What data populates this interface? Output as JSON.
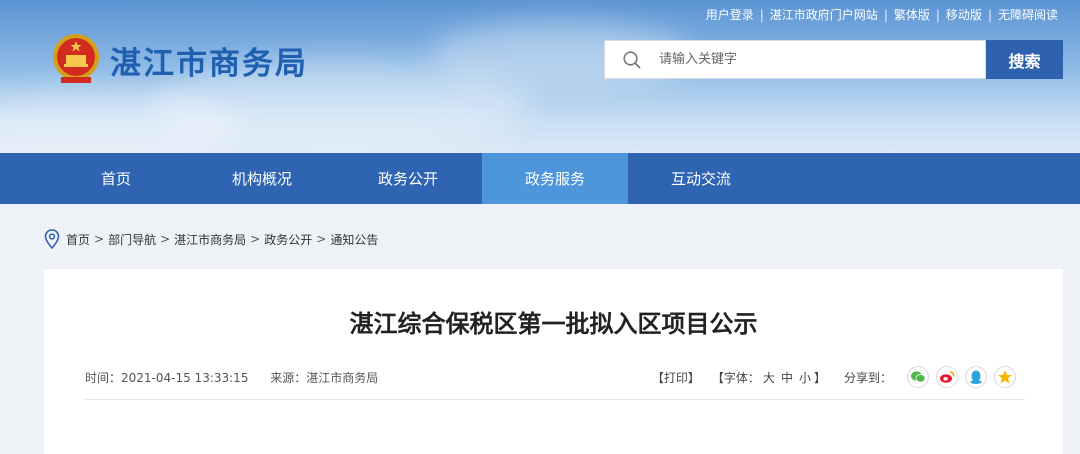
{
  "header": {
    "site_title": "湛江市商务局",
    "top_links": [
      "用户登录",
      "湛江市政府门户网站",
      "繁体版",
      "移动版",
      "无障碍阅读"
    ],
    "top_sep": "|",
    "search": {
      "placeholder": "请输入关键字",
      "button_label": "搜索"
    }
  },
  "nav": {
    "items": [
      "首页",
      "机构概况",
      "政务公开",
      "政务服务",
      "互动交流"
    ],
    "active_index": 3
  },
  "breadcrumb": {
    "items": [
      "首页",
      "部门导航",
      "湛江市商务局",
      "政务公开",
      "通知公告"
    ],
    "separator": ">"
  },
  "article": {
    "title": "湛江综合保税区第一批拟入区项目公示",
    "time": "时间：2021-04-15 13:33:15",
    "source": "来源：湛江市商务局",
    "print_label": "【打印】",
    "font_prefix": "【字体：",
    "font_sizes": [
      "大",
      "中",
      "小"
    ],
    "font_suffix": "】",
    "share_label": "分享到："
  },
  "colors": {
    "nav_bg": "#2f64b2",
    "nav_active": "#4d96dc",
    "title_blue": "#1e5fb0",
    "search_btn": "#2f62ae"
  },
  "icons": [
    "national-emblem-icon",
    "search-icon",
    "location-pin-icon",
    "wechat-icon",
    "weibo-icon",
    "qq-icon",
    "qzone-icon"
  ]
}
